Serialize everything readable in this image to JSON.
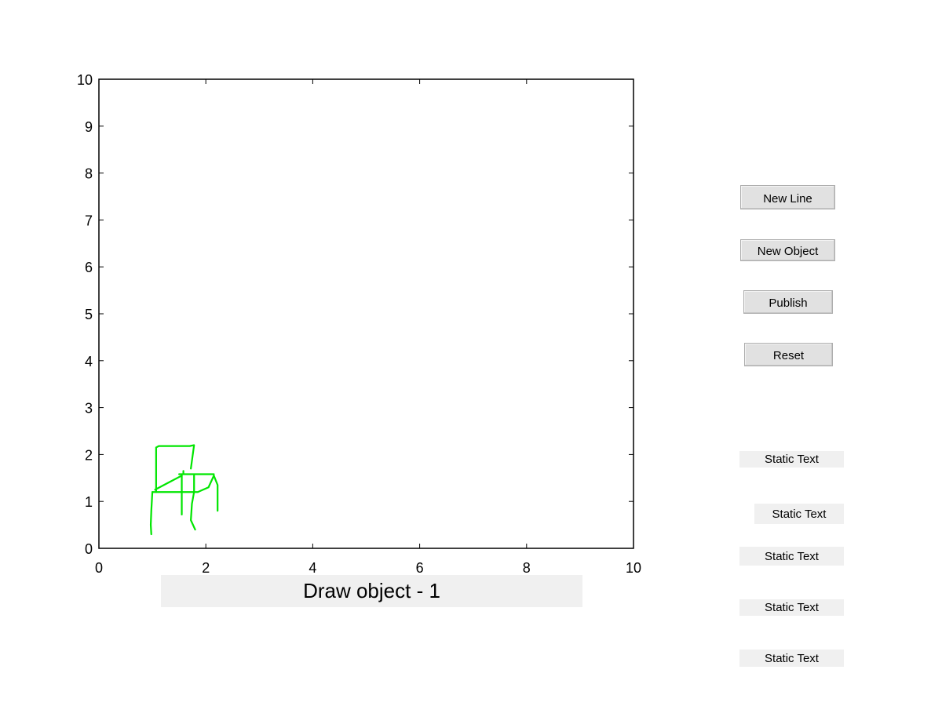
{
  "axes": {
    "x_ticks": [
      "0",
      "2",
      "4",
      "6",
      "8",
      "10"
    ],
    "y_ticks": [
      "0",
      "1",
      "2",
      "3",
      "4",
      "5",
      "6",
      "7",
      "8",
      "9",
      "10"
    ]
  },
  "chart_data": {
    "type": "line",
    "xlim": [
      0,
      10
    ],
    "ylim": [
      0,
      10
    ],
    "grid": false,
    "line_color": "#00e600",
    "series": [
      {
        "values": [
          [
            1.07,
            1.2
          ],
          [
            1.07,
            2.15
          ],
          [
            1.12,
            2.18
          ],
          [
            1.7,
            2.18
          ],
          [
            1.78,
            2.2
          ],
          [
            1.72,
            1.7
          ]
        ]
      },
      {
        "values": [
          [
            1.05,
            1.25
          ],
          [
            1.3,
            1.4
          ],
          [
            1.55,
            1.55
          ]
        ]
      },
      {
        "values": [
          [
            1.0,
            1.2
          ],
          [
            1.85,
            1.2
          ],
          [
            2.05,
            1.3
          ],
          [
            2.15,
            1.55
          ]
        ]
      },
      {
        "values": [
          [
            1.5,
            1.58
          ],
          [
            2.15,
            1.58
          ]
        ]
      },
      {
        "values": [
          [
            1.58,
            1.65
          ],
          [
            1.58,
            1.6
          ]
        ]
      },
      {
        "values": [
          [
            1.55,
            1.55
          ],
          [
            1.55,
            0.72
          ]
        ]
      },
      {
        "values": [
          [
            1.78,
            1.55
          ],
          [
            1.78,
            1.2
          ],
          [
            1.74,
            0.95
          ],
          [
            1.72,
            0.6
          ],
          [
            1.8,
            0.4
          ]
        ]
      },
      {
        "values": [
          [
            1.0,
            1.2
          ],
          [
            0.98,
            0.8
          ],
          [
            0.97,
            0.5
          ],
          [
            0.98,
            0.3
          ]
        ]
      },
      {
        "values": [
          [
            2.15,
            1.55
          ],
          [
            2.22,
            1.35
          ],
          [
            2.22,
            0.8
          ]
        ]
      }
    ]
  },
  "buttons": {
    "new_line": "New Line",
    "new_object": "New Object",
    "publish": "Publish",
    "reset": "Reset"
  },
  "static_texts": [
    "Static Text",
    "Static Text",
    "Static Text",
    "Static Text",
    "Static Text"
  ],
  "status": "Draw object - 1"
}
